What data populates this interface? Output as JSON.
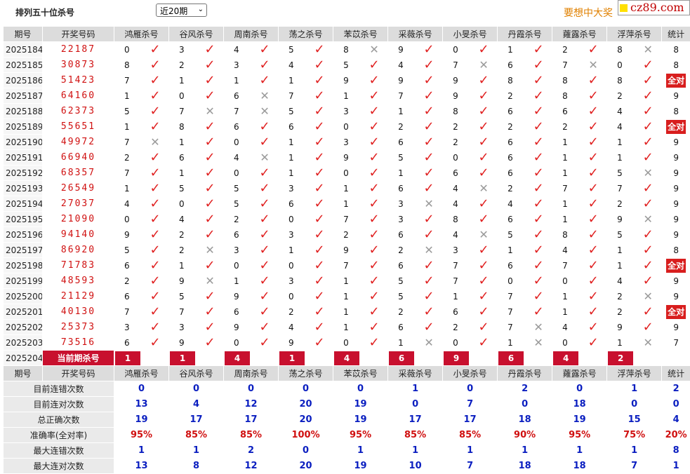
{
  "header": {
    "title": "排列五十位杀号",
    "period_select": "近20期",
    "promo_text": "要想中大奖",
    "logo_text": "cz89.com"
  },
  "columns": {
    "period": "期号",
    "draw": "开奖号码",
    "methods": [
      "鸿雁杀号",
      "谷风杀号",
      "周南杀号",
      "荡之杀号",
      "苯苡杀号",
      "采薇杀号",
      "小旻杀号",
      "丹霞杀号",
      "蕹露杀号",
      "浮萍杀号"
    ],
    "stat": "统计"
  },
  "all_correct_label": "全对",
  "current_row": {
    "label": "当前期杀号",
    "period": "2025204",
    "kills": [
      "1",
      "1",
      "4",
      "1",
      "4",
      "6",
      "9",
      "6",
      "4",
      "2"
    ]
  },
  "rows": [
    {
      "period": "2025184",
      "draw": "22187",
      "kills": [
        "0",
        "3",
        "4",
        "5",
        "8",
        "9",
        "0",
        "1",
        "2",
        "8"
      ],
      "ok": [
        1,
        1,
        1,
        1,
        0,
        1,
        1,
        1,
        1,
        0
      ],
      "stat": "8"
    },
    {
      "period": "2025185",
      "draw": "30873",
      "kills": [
        "8",
        "2",
        "3",
        "4",
        "5",
        "4",
        "7",
        "6",
        "7",
        "0"
      ],
      "ok": [
        1,
        1,
        1,
        1,
        1,
        1,
        0,
        1,
        0,
        1
      ],
      "stat": "8"
    },
    {
      "period": "2025186",
      "draw": "51423",
      "kills": [
        "7",
        "1",
        "1",
        "1",
        "9",
        "9",
        "9",
        "8",
        "8",
        "8"
      ],
      "ok": [
        1,
        1,
        1,
        1,
        1,
        1,
        1,
        1,
        1,
        1
      ],
      "stat": "全对"
    },
    {
      "period": "2025187",
      "draw": "64160",
      "kills": [
        "1",
        "0",
        "6",
        "7",
        "1",
        "7",
        "9",
        "2",
        "8",
        "2"
      ],
      "ok": [
        1,
        1,
        0,
        1,
        1,
        1,
        1,
        1,
        1,
        1
      ],
      "stat": "9"
    },
    {
      "period": "2025188",
      "draw": "62373",
      "kills": [
        "5",
        "7",
        "7",
        "5",
        "3",
        "1",
        "8",
        "6",
        "6",
        "4"
      ],
      "ok": [
        1,
        0,
        0,
        1,
        1,
        1,
        1,
        1,
        1,
        1
      ],
      "stat": "8"
    },
    {
      "period": "2025189",
      "draw": "55651",
      "kills": [
        "1",
        "8",
        "6",
        "6",
        "0",
        "2",
        "2",
        "2",
        "2",
        "4"
      ],
      "ok": [
        1,
        1,
        1,
        1,
        1,
        1,
        1,
        1,
        1,
        1
      ],
      "stat": "全对"
    },
    {
      "period": "2025190",
      "draw": "49972",
      "kills": [
        "7",
        "1",
        "0",
        "1",
        "3",
        "6",
        "2",
        "6",
        "1",
        "1"
      ],
      "ok": [
        0,
        1,
        1,
        1,
        1,
        1,
        1,
        1,
        1,
        1
      ],
      "stat": "9"
    },
    {
      "period": "2025191",
      "draw": "66940",
      "kills": [
        "2",
        "6",
        "4",
        "1",
        "9",
        "5",
        "0",
        "6",
        "1",
        "1"
      ],
      "ok": [
        1,
        1,
        0,
        1,
        1,
        1,
        1,
        1,
        1,
        1
      ],
      "stat": "9"
    },
    {
      "period": "2025192",
      "draw": "68357",
      "kills": [
        "7",
        "1",
        "0",
        "1",
        "0",
        "1",
        "6",
        "6",
        "1",
        "5"
      ],
      "ok": [
        1,
        1,
        1,
        1,
        1,
        1,
        1,
        1,
        1,
        0
      ],
      "stat": "9"
    },
    {
      "period": "2025193",
      "draw": "26549",
      "kills": [
        "1",
        "5",
        "5",
        "3",
        "1",
        "6",
        "4",
        "2",
        "7",
        "7"
      ],
      "ok": [
        1,
        1,
        1,
        1,
        1,
        1,
        0,
        1,
        1,
        1
      ],
      "stat": "9"
    },
    {
      "period": "2025194",
      "draw": "27037",
      "kills": [
        "4",
        "0",
        "5",
        "6",
        "1",
        "3",
        "4",
        "4",
        "1",
        "2"
      ],
      "ok": [
        1,
        1,
        1,
        1,
        1,
        0,
        1,
        1,
        1,
        1
      ],
      "stat": "9"
    },
    {
      "period": "2025195",
      "draw": "21090",
      "kills": [
        "0",
        "4",
        "2",
        "0",
        "7",
        "3",
        "8",
        "6",
        "1",
        "9"
      ],
      "ok": [
        1,
        1,
        1,
        1,
        1,
        1,
        1,
        1,
        1,
        0
      ],
      "stat": "9"
    },
    {
      "period": "2025196",
      "draw": "94140",
      "kills": [
        "9",
        "2",
        "6",
        "3",
        "2",
        "6",
        "4",
        "5",
        "8",
        "5"
      ],
      "ok": [
        1,
        1,
        1,
        1,
        1,
        1,
        0,
        1,
        1,
        1
      ],
      "stat": "9"
    },
    {
      "period": "2025197",
      "draw": "86920",
      "kills": [
        "5",
        "2",
        "3",
        "1",
        "9",
        "2",
        "3",
        "1",
        "4",
        "1"
      ],
      "ok": [
        1,
        0,
        1,
        1,
        1,
        0,
        1,
        1,
        1,
        1
      ],
      "stat": "8"
    },
    {
      "period": "2025198",
      "draw": "71783",
      "kills": [
        "6",
        "1",
        "0",
        "0",
        "7",
        "6",
        "7",
        "6",
        "7",
        "1"
      ],
      "ok": [
        1,
        1,
        1,
        1,
        1,
        1,
        1,
        1,
        1,
        1
      ],
      "stat": "全对"
    },
    {
      "period": "2025199",
      "draw": "48593",
      "kills": [
        "2",
        "9",
        "1",
        "3",
        "1",
        "5",
        "7",
        "0",
        "0",
        "4"
      ],
      "ok": [
        1,
        0,
        1,
        1,
        1,
        1,
        1,
        1,
        1,
        1
      ],
      "stat": "9"
    },
    {
      "period": "2025200",
      "draw": "21129",
      "kills": [
        "6",
        "5",
        "9",
        "0",
        "1",
        "5",
        "1",
        "7",
        "1",
        "2"
      ],
      "ok": [
        1,
        1,
        1,
        1,
        1,
        1,
        1,
        1,
        1,
        0
      ],
      "stat": "9"
    },
    {
      "period": "2025201",
      "draw": "40130",
      "kills": [
        "7",
        "7",
        "6",
        "2",
        "1",
        "2",
        "6",
        "7",
        "1",
        "2"
      ],
      "ok": [
        1,
        1,
        1,
        1,
        1,
        1,
        1,
        1,
        1,
        1
      ],
      "stat": "全对"
    },
    {
      "period": "2025202",
      "draw": "25373",
      "kills": [
        "3",
        "3",
        "9",
        "4",
        "1",
        "6",
        "2",
        "7",
        "4",
        "9"
      ],
      "ok": [
        1,
        1,
        1,
        1,
        1,
        1,
        1,
        0,
        1,
        1
      ],
      "stat": "9"
    },
    {
      "period": "2025203",
      "draw": "73516",
      "kills": [
        "6",
        "9",
        "0",
        "9",
        "0",
        "1",
        "0",
        "1",
        "0",
        "1"
      ],
      "ok": [
        1,
        1,
        1,
        1,
        1,
        0,
        1,
        0,
        1,
        0
      ],
      "stat": "7"
    }
  ],
  "summary": [
    {
      "label": "目前连错次数",
      "values": [
        "0",
        "0",
        "0",
        "0",
        "0",
        "1",
        "0",
        "2",
        "0",
        "1"
      ],
      "stat": "2",
      "red": false
    },
    {
      "label": "目前连对次数",
      "values": [
        "13",
        "4",
        "12",
        "20",
        "19",
        "0",
        "7",
        "0",
        "18",
        "0"
      ],
      "stat": "0",
      "red": false
    },
    {
      "label": "总正确次数",
      "values": [
        "19",
        "17",
        "17",
        "20",
        "19",
        "17",
        "17",
        "18",
        "19",
        "15"
      ],
      "stat": "4",
      "red": false
    },
    {
      "label": "准确率(全对率)",
      "values": [
        "95%",
        "85%",
        "85%",
        "100%",
        "95%",
        "85%",
        "85%",
        "90%",
        "95%",
        "75%"
      ],
      "stat": "20%",
      "red": true
    },
    {
      "label": "最大连错次数",
      "values": [
        "1",
        "1",
        "2",
        "0",
        "1",
        "1",
        "1",
        "1",
        "1",
        "1"
      ],
      "stat": "8",
      "red": false
    },
    {
      "label": "最大连对次数",
      "values": [
        "13",
        "8",
        "12",
        "20",
        "19",
        "10",
        "7",
        "18",
        "18",
        "7"
      ],
      "stat": "1",
      "red": false
    }
  ],
  "icons": {
    "correct": "check-mark-icon",
    "wrong": "cross-mark-icon"
  },
  "colors": {
    "accent_red": "#c8102e",
    "draw_red": "#d01010",
    "summary_blue": "#0a1ec0",
    "promo_orange": "#e08000"
  }
}
